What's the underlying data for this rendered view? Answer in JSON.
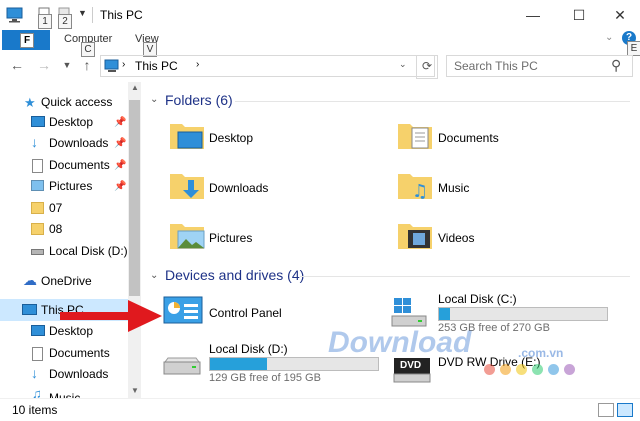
{
  "window": {
    "title": "This PC",
    "keytips": [
      "1",
      "2",
      "C",
      "V",
      "E"
    ],
    "file_tab": "F"
  },
  "ribbon": {
    "tabs": [
      "Computer",
      "View"
    ]
  },
  "address": {
    "path": "This PC",
    "search_placeholder": "Search This PC"
  },
  "nav": {
    "items": [
      {
        "label": "Quick access",
        "icon": "star-icon"
      },
      {
        "label": "Desktop",
        "icon": "desktop-icon",
        "pinned": true
      },
      {
        "label": "Downloads",
        "icon": "download-icon",
        "pinned": true
      },
      {
        "label": "Documents",
        "icon": "documents-icon",
        "pinned": true
      },
      {
        "label": "Pictures",
        "icon": "pictures-icon",
        "pinned": true
      },
      {
        "label": "07",
        "icon": "folder-icon"
      },
      {
        "label": "08",
        "icon": "folder-icon"
      },
      {
        "label": "Local Disk (D:)",
        "icon": "drive-icon"
      },
      {
        "label": "OneDrive",
        "icon": "cloud-icon"
      },
      {
        "label": "This PC",
        "icon": "computer-icon",
        "selected": true
      },
      {
        "label": "Desktop",
        "icon": "desktop-icon"
      },
      {
        "label": "Documents",
        "icon": "documents-icon"
      },
      {
        "label": "Downloads",
        "icon": "download-icon"
      },
      {
        "label": "Music",
        "icon": "music-icon"
      }
    ]
  },
  "folders": {
    "header": "Folders (6)",
    "items": [
      "Desktop",
      "Documents",
      "Downloads",
      "Music",
      "Pictures",
      "Videos"
    ]
  },
  "devices": {
    "header": "Devices and drives (4)",
    "items": [
      {
        "label": "Control Panel"
      },
      {
        "label": "Local Disk (C:)",
        "free": "253 GB free of 270 GB",
        "used_fraction": 0.063
      },
      {
        "label": "Local Disk (D:)",
        "free": "129 GB free of 195 GB",
        "used_fraction": 0.338
      },
      {
        "label": "DVD RW Drive (E:)",
        "badge": "DVD"
      }
    ]
  },
  "status": {
    "count": "10 items"
  },
  "watermark": {
    "text": "Download",
    "suffix": ".com.vn"
  },
  "colors": {
    "accent": "#1979ca",
    "selected": "#cce8ff",
    "arrow": "#e0191e",
    "bar_fill": "#26a0da"
  }
}
